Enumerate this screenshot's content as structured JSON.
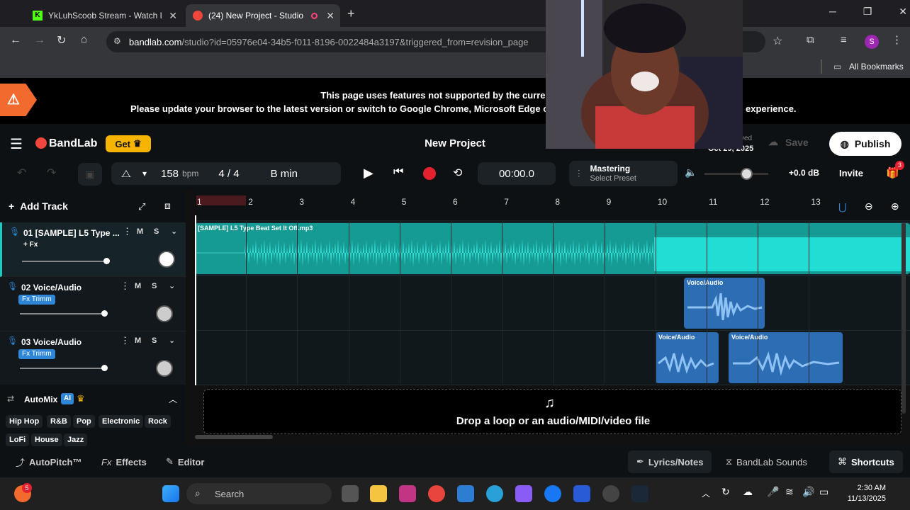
{
  "browser": {
    "tabs": [
      {
        "label": "YkLuhScoob Stream - Watch Liv"
      },
      {
        "label": "(24) New Project - Studio"
      }
    ],
    "url_domain": "bandlab.com",
    "url_path": "/studio?id=05976e04-34b5-f011-8196-0022484a3197&triggered_from=revision_page",
    "bookmarks_label": "All Bookmarks",
    "profile_initial": "S"
  },
  "warning": {
    "line1": "This page uses features not supported by the current version",
    "line2": "Please update your browser to the latest version or switch to Google Chrome, Microsoft Edge or M",
    "line2_end": "experience."
  },
  "header": {
    "logo": "BandLab",
    "get_label": "Get",
    "title": "New Project",
    "saved_label": "ved",
    "saved_date": "Oct 29, 2025",
    "save_label": "Save",
    "publish_label": "Publish"
  },
  "controls": {
    "bpm_value": "158",
    "bpm_unit": "bpm",
    "time_sig": "4 / 4",
    "key": "B min",
    "time": "00:00.0",
    "mastering_label": "Mastering",
    "mastering_preset": "Select Preset",
    "volume_db": "+0.0 dB",
    "invite_label": "Invite",
    "notification_count": "3"
  },
  "tracks_panel": {
    "add_track_label": "Add Track",
    "mute_label": "M",
    "solo_label": "S",
    "tracks": [
      {
        "name": "01  [SAMPLE] L5 Type ...",
        "badge": "+ Fx"
      },
      {
        "name": "02  Voice/Audio",
        "badge": "Fx Trimm"
      },
      {
        "name": "03  Voice/Audio",
        "badge": "Fx Trimm"
      }
    ]
  },
  "ruler": {
    "bars": [
      "1",
      "2",
      "3",
      "4",
      "5",
      "6",
      "7",
      "8",
      "9",
      "10",
      "11",
      "12",
      "13"
    ]
  },
  "clips": {
    "sample": "[SAMPLE] L5 Type Beat Set It Off.mp3",
    "voice": "Voice/Audio"
  },
  "automix": {
    "label": "AutoMix",
    "ai_badge": "AI",
    "genres": [
      "Hip Hop",
      "R&B",
      "Pop",
      "Electronic",
      "Rock",
      "LoFi",
      "House",
      "Jazz"
    ]
  },
  "dropzone": {
    "text": "Drop a loop or an audio/MIDI/video file"
  },
  "bottom": {
    "autopitch": "AutoPitch™",
    "effects": "Effects",
    "editor": "Editor",
    "lyrics": "Lyrics/Notes",
    "sounds": "BandLab Sounds",
    "shortcuts": "Shortcuts"
  },
  "taskbar": {
    "search_placeholder": "Search",
    "time": "2:30 AM",
    "date": "11/13/2025",
    "app_badge": "5"
  },
  "colors": {
    "accent": "#1ec8c0",
    "record": "#e5202f",
    "get_badge": "#f5b400",
    "brand_red": "#f0463c"
  }
}
